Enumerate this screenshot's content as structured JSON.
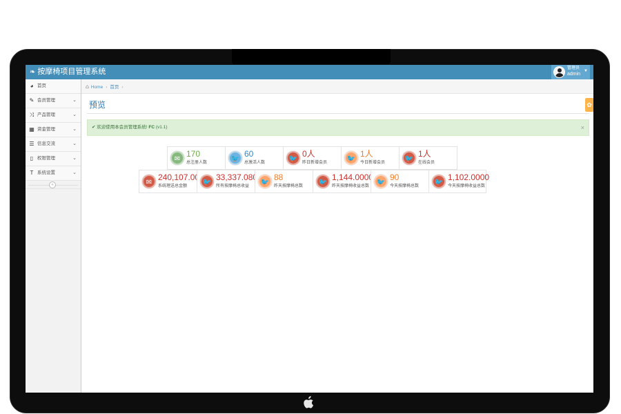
{
  "app": {
    "title": "按摩椅项目管理系统",
    "user_role": "管理员",
    "user_name": "admin"
  },
  "sidebar": {
    "items": [
      {
        "label": "首页",
        "icon": "dashboard-icon",
        "has_submenu": false
      },
      {
        "label": "会员管理",
        "icon": "edit-icon",
        "has_submenu": true
      },
      {
        "label": "产品管理",
        "icon": "random-icon",
        "has_submenu": true
      },
      {
        "label": "资金管理",
        "icon": "calendar-icon",
        "has_submenu": true
      },
      {
        "label": "信息交流",
        "icon": "list-icon",
        "has_submenu": true
      },
      {
        "label": "权限管理",
        "icon": "file-icon",
        "has_submenu": true
      },
      {
        "label": "系统设置",
        "icon": "text-width-icon",
        "has_submenu": true
      }
    ]
  },
  "breadcrumb": {
    "home": "Home",
    "current": "首页"
  },
  "page": {
    "title": "预览"
  },
  "alert": {
    "text": "欢迎使用本会员管理系统!",
    "brand": "FC",
    "version": "(v1.1)"
  },
  "stats": {
    "row1": [
      {
        "value": "170",
        "label": "总注册人数",
        "color": "#87b87f",
        "icon": "comments-icon"
      },
      {
        "value": "60",
        "label": "总激活人数",
        "color": "#6fb3e0",
        "icon": "twitter-icon"
      },
      {
        "value": "0人",
        "label": "昨日新增会员",
        "color": "#d15b47",
        "icon": "twitter-icon"
      },
      {
        "value": "1人",
        "label": "今日新增会员",
        "color": "#fea56e",
        "icon": "twitter-icon"
      },
      {
        "value": "1人",
        "label": "在线会员",
        "color": "#d15b47",
        "icon": "twitter-icon"
      }
    ],
    "row2": [
      {
        "value": "240,107.00",
        "label": "系统理送总金额",
        "color": "#d15b47",
        "icon": "comments-icon"
      },
      {
        "value": "33,337.0800",
        "label": "所有按摩椅总收益",
        "color": "#d15b47",
        "icon": "twitter-icon"
      },
      {
        "value": "88",
        "label": "昨天按摩椅总数",
        "color": "#fea56e",
        "icon": "twitter-icon"
      },
      {
        "value": "1,144.0000",
        "label": "昨天按摩椅收益总数",
        "color": "#d15b47",
        "icon": "twitter-icon"
      },
      {
        "value": "90",
        "label": "今天按摩椅总数",
        "color": "#fea56e",
        "icon": "twitter-icon"
      },
      {
        "value": "1,102.0000",
        "label": "今天按摩椅收益总数",
        "color": "#d15b47",
        "icon": "twitter-icon"
      }
    ]
  }
}
